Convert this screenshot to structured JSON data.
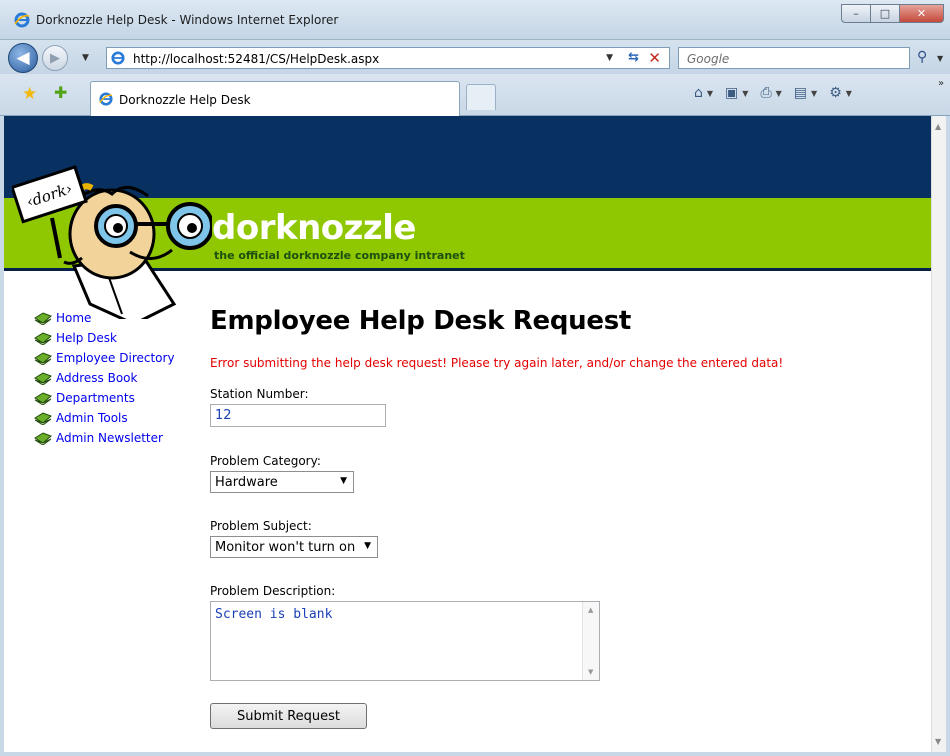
{
  "window": {
    "title": "Dorknozzle Help Desk - Windows Internet Explorer",
    "controls": [
      "–",
      "□",
      "✕"
    ]
  },
  "browser": {
    "url": "http://localhost:52481/CS/HelpDesk.aspx",
    "search_placeholder": "Google",
    "tab_title": "Dorknozzle Help Desk"
  },
  "site": {
    "brand": "dorknozzle",
    "tagline": "the official dorknozzle company intranet",
    "logo_sign": "‹dork›"
  },
  "sidebar": {
    "items": [
      {
        "label": "Home"
      },
      {
        "label": "Help Desk"
      },
      {
        "label": "Employee Directory"
      },
      {
        "label": "Address Book"
      },
      {
        "label": "Departments"
      },
      {
        "label": "Admin Tools"
      },
      {
        "label": "Admin Newsletter"
      }
    ]
  },
  "form": {
    "heading": "Employee Help Desk Request",
    "error": "Error submitting the help desk request! Please try again later, and/or change the entered data!",
    "station_label": "Station Number:",
    "station_value": "12",
    "category_label": "Problem Category:",
    "category_value": "Hardware",
    "subject_label": "Problem Subject:",
    "subject_value": "Monitor won't turn on",
    "description_label": "Problem Description:",
    "description_value": "Screen is blank",
    "submit_label": "Submit Request"
  },
  "colors": {
    "header_navy": "#083161",
    "header_green": "#8fc700",
    "error_red": "#e40000",
    "link_blue": "#0000ee"
  }
}
